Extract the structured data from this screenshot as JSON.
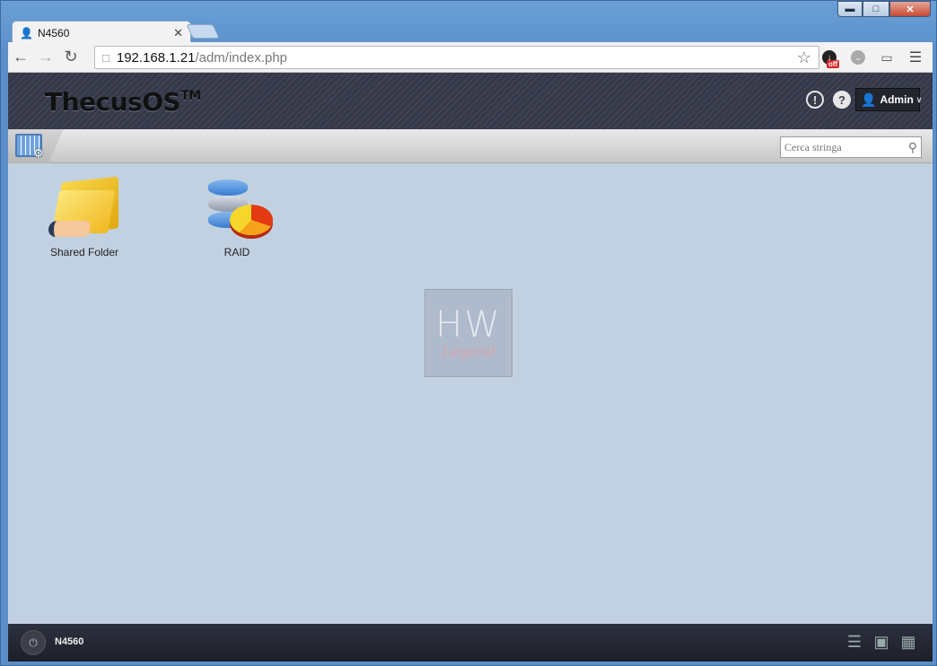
{
  "browser": {
    "tab_title": "N4560",
    "url_host": "192.168.1.21",
    "url_path": "/adm/index.php",
    "ext_badge": "off"
  },
  "header": {
    "logo": "ThecusOS",
    "logo_tm": "TM",
    "user_label": "Admin"
  },
  "subbar": {
    "search_placeholder": "Cerca stringa"
  },
  "desktop": {
    "apps": [
      {
        "label": "Shared Folder",
        "icon": "shared-folder-icon"
      },
      {
        "label": "RAID",
        "icon": "raid-icon"
      }
    ],
    "watermark_top": "HW",
    "watermark_bottom": "Legend"
  },
  "footer": {
    "device_name": "N4560"
  },
  "colors": {
    "desktop_bg": "#c2d1e2",
    "header_bg": "#3a3d4c",
    "footer_bg": "#23252e"
  }
}
